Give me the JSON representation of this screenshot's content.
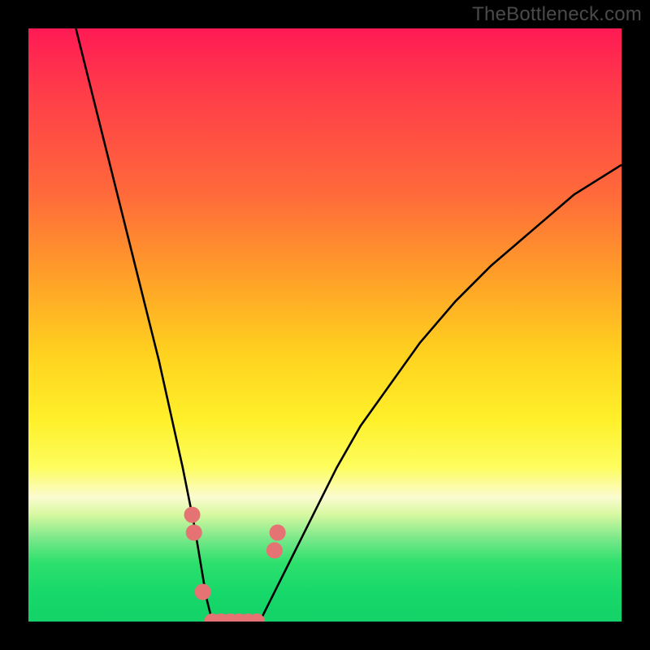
{
  "watermark": "TheBottleneck.com",
  "chart_data": {
    "type": "line",
    "title": "",
    "xlabel": "",
    "ylabel": "",
    "xlim": [
      0,
      100
    ],
    "ylim": [
      0,
      100
    ],
    "series": [
      {
        "name": "left_curve",
        "x": [
          8,
          10,
          12,
          14,
          16,
          18,
          20,
          22,
          24,
          26,
          28,
          29,
          30,
          31
        ],
        "y": [
          100,
          92,
          84,
          76,
          68,
          60,
          52,
          44,
          35,
          26,
          16,
          10,
          4,
          0
        ]
      },
      {
        "name": "trough",
        "x": [
          31,
          33,
          35,
          37,
          39
        ],
        "y": [
          0,
          0,
          0,
          0,
          0
        ]
      },
      {
        "name": "right_curve",
        "x": [
          39,
          41,
          44,
          48,
          52,
          56,
          61,
          66,
          72,
          78,
          85,
          92,
          100
        ],
        "y": [
          0,
          4,
          10,
          18,
          26,
          33,
          40,
          47,
          54,
          60,
          66,
          72,
          77
        ]
      },
      {
        "name": "marker_left_upper",
        "type": "scatter",
        "x": [
          27.6,
          27.9
        ],
        "y": [
          18,
          15
        ],
        "color": "#e57373"
      },
      {
        "name": "marker_left_lower",
        "type": "scatter",
        "x": [
          29.4
        ],
        "y": [
          5
        ],
        "color": "#e57373"
      },
      {
        "name": "marker_trough",
        "type": "scatter",
        "x": [
          31,
          32.5,
          34,
          35.5,
          37,
          38.5
        ],
        "y": [
          0,
          0,
          0,
          0,
          0,
          0
        ],
        "color": "#e57373"
      },
      {
        "name": "marker_right_upper",
        "type": "scatter",
        "x": [
          41.5,
          42
        ],
        "y": [
          12,
          15
        ],
        "color": "#e57373"
      }
    ],
    "gradient_background": {
      "direction": "vertical",
      "stops": [
        {
          "pos": 0.0,
          "color": "#ff1a54"
        },
        {
          "pos": 0.28,
          "color": "#ff6a3a"
        },
        {
          "pos": 0.55,
          "color": "#ffd21f"
        },
        {
          "pos": 0.79,
          "color": "#fbfbd0"
        },
        {
          "pos": 0.9,
          "color": "#2ee06d"
        },
        {
          "pos": 1.0,
          "color": "#13d268"
        }
      ]
    }
  }
}
